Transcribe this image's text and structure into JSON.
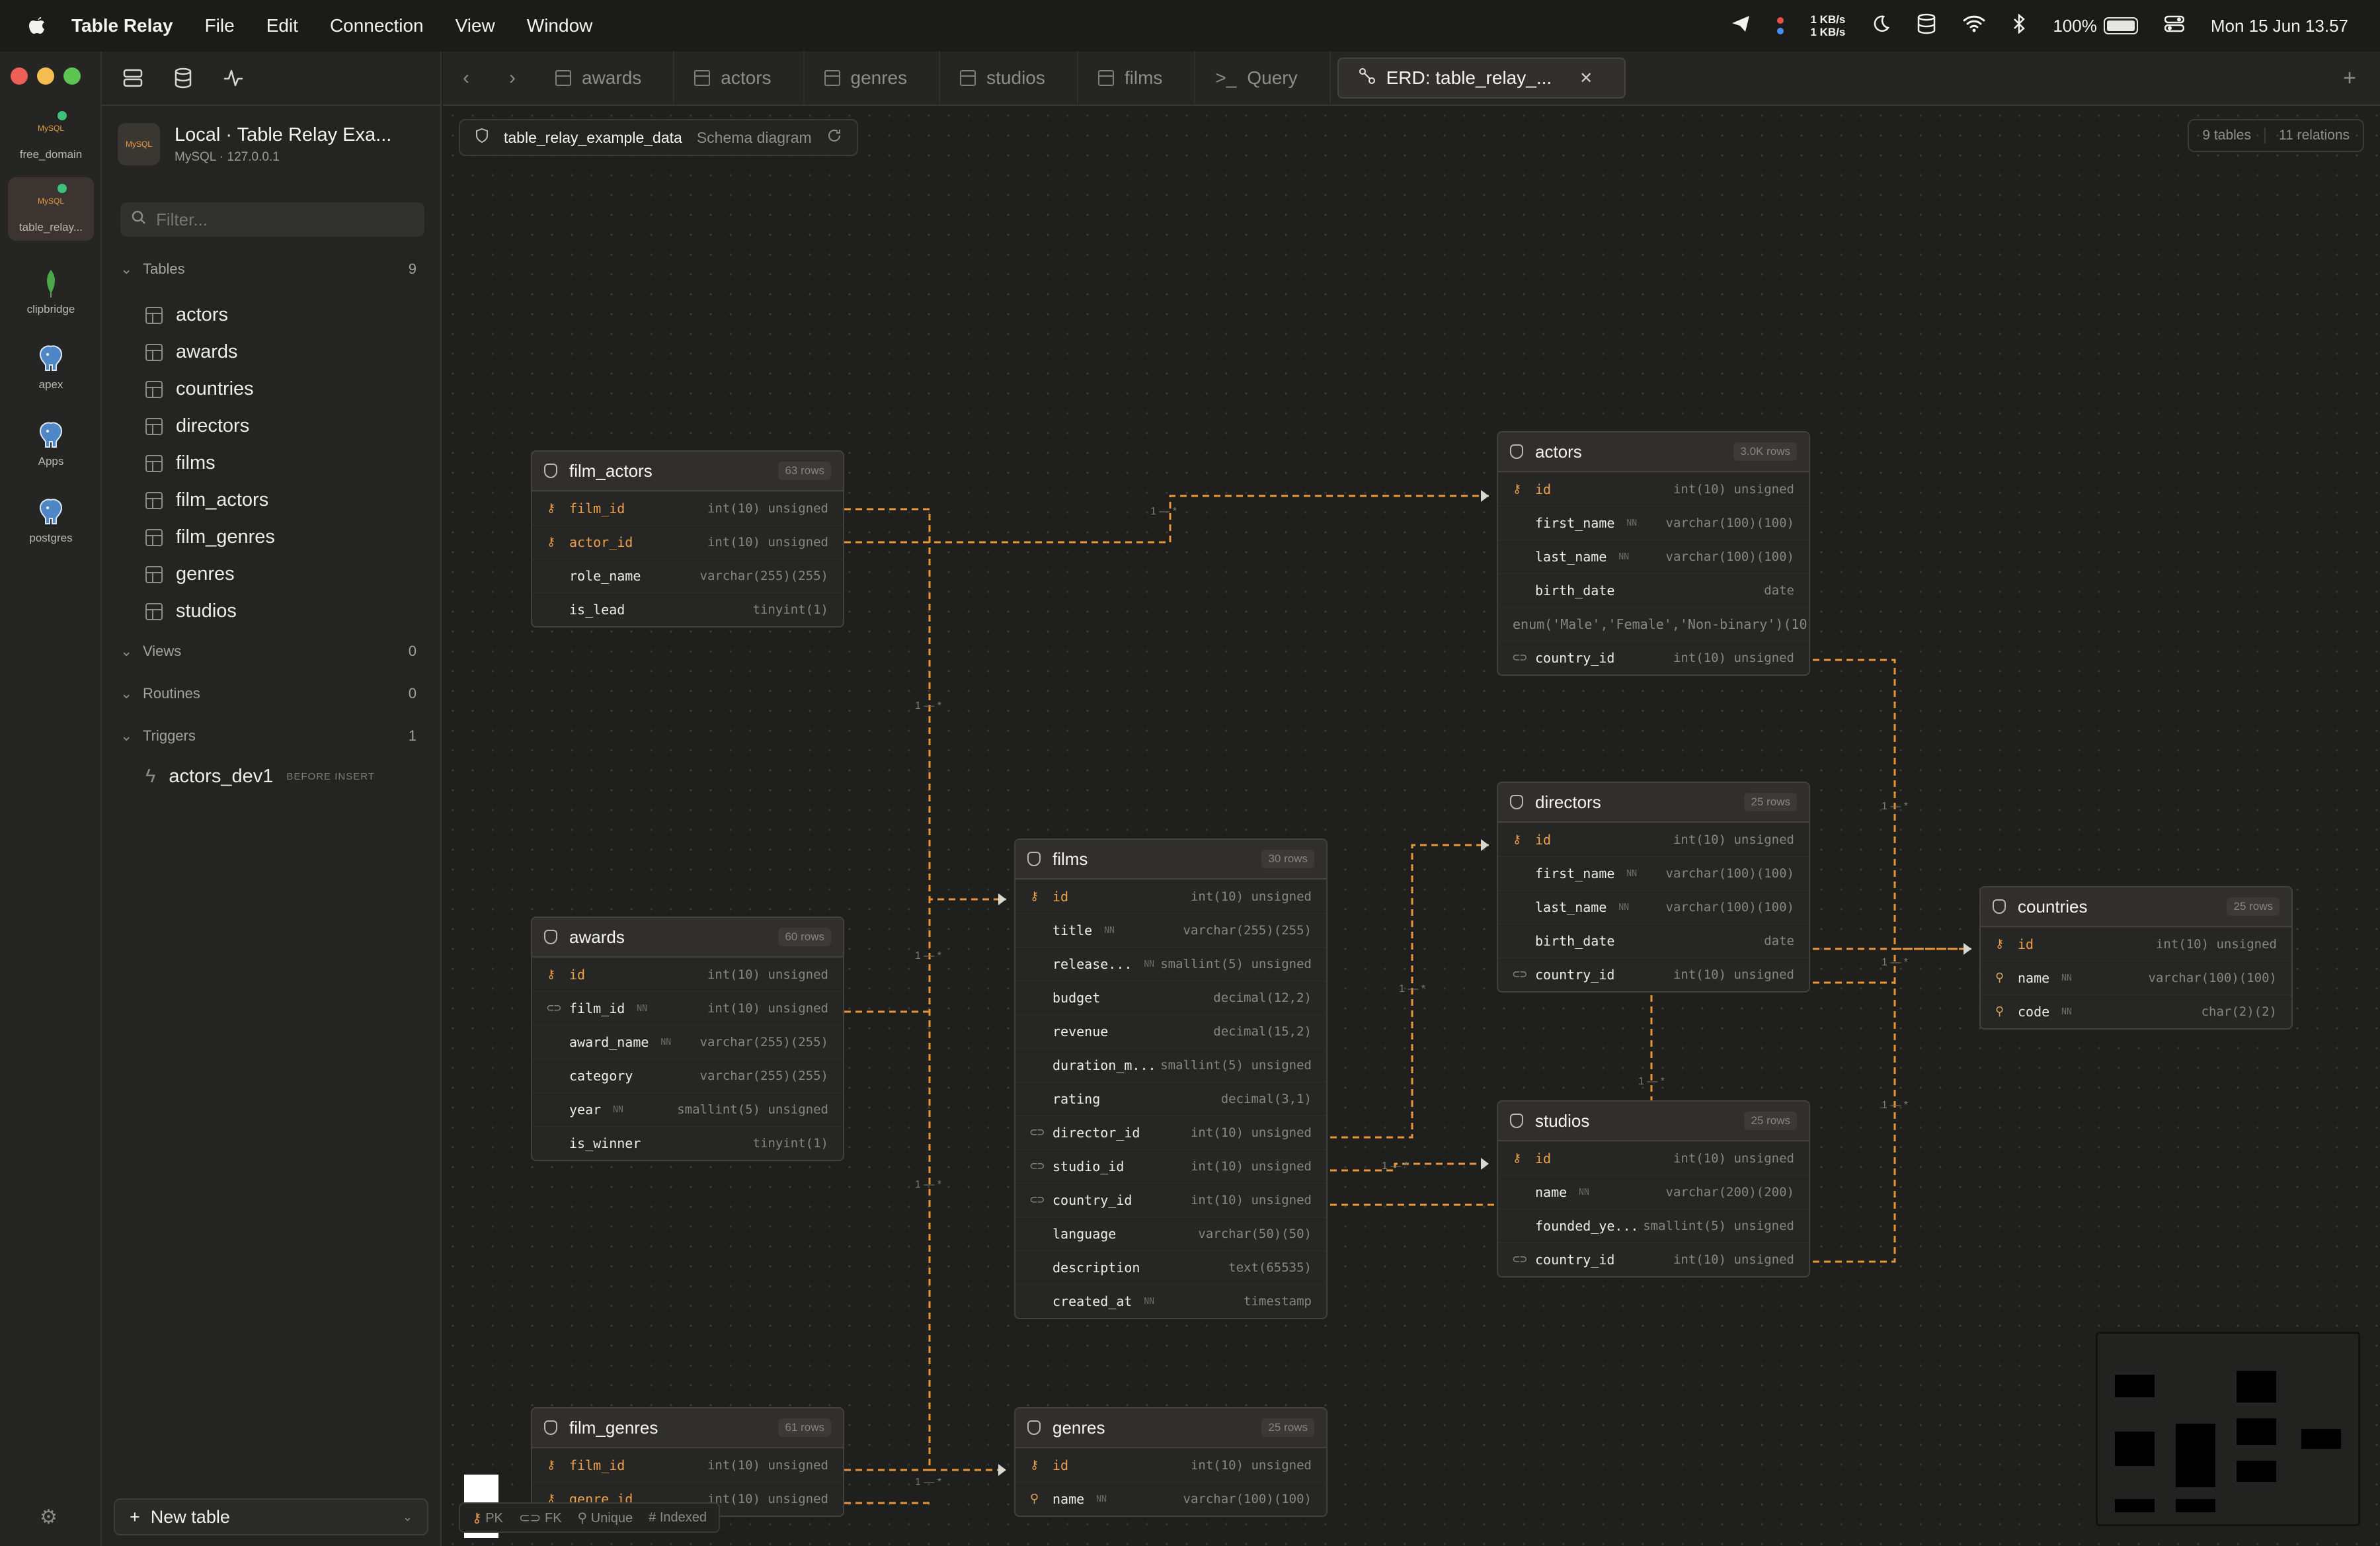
{
  "menubar": {
    "app": "Table Relay",
    "items": [
      "File",
      "Edit",
      "Connection",
      "View",
      "Window"
    ],
    "net_up": "1 KB/s",
    "net_down": "1 KB/s",
    "battery": "100%",
    "clock": "Mon 15 Jun  13.57"
  },
  "connections": [
    {
      "label": "free_domain",
      "icon": "mysql-icon"
    },
    {
      "label": "table_relay...",
      "icon": "mysql-icon"
    },
    {
      "label": "clipbridge",
      "icon": "mongodb-leaf-icon"
    },
    {
      "label": "apex",
      "icon": "postgres-elephant-icon"
    },
    {
      "label": "Apps",
      "icon": "postgres-elephant-icon"
    },
    {
      "label": "postgres",
      "icon": "postgres-elephant-icon"
    }
  ],
  "sidebar": {
    "db_title": "Local · Table Relay Exa...",
    "db_sub": "MySQL · 127.0.0.1",
    "filter_placeholder": "Filter...",
    "tables_label": "Tables",
    "tables_count": "9",
    "tables": [
      "actors",
      "awards",
      "countries",
      "directors",
      "films",
      "film_actors",
      "film_genres",
      "genres",
      "studios"
    ],
    "views_label": "Views",
    "views_count": "0",
    "routines_label": "Routines",
    "routines_count": "0",
    "triggers_label": "Triggers",
    "triggers_count": "1",
    "trigger_name": "actors_dev1",
    "trigger_tag": "BEFORE INSERT",
    "new_table": "New table"
  },
  "tabs": [
    "awards",
    "actors",
    "genres",
    "studios",
    "films",
    "Query",
    "ERD: table_relay_..."
  ],
  "erd": {
    "db": "table_relay_example_data",
    "sub": "Schema diagram",
    "stats_tables": "9 tables",
    "stats_relations": "11 relations",
    "legend": [
      "PK",
      "FK",
      "Unique",
      "Indexed"
    ],
    "cardinality": "1 — *",
    "line_color": "#e8953a"
  },
  "tables": {
    "film_actors": {
      "name": "film_actors",
      "rows": "63 rows",
      "cols": [
        {
          "n": "film_id",
          "t": "int(10) unsigned"
        },
        {
          "n": "actor_id",
          "t": "int(10) unsigned"
        },
        {
          "n": "role_name",
          "t": "varchar(255)(255)"
        },
        {
          "n": "is_lead",
          "t": "tinyint(1)"
        }
      ]
    },
    "awards": {
      "name": "awards",
      "rows": "60 rows",
      "cols": [
        {
          "n": "id",
          "t": "int(10) unsigned"
        },
        {
          "n": "film_id",
          "nn": "NN",
          "t": "int(10) unsigned"
        },
        {
          "n": "award_name",
          "nn": "NN",
          "t": "varchar(255)(255)"
        },
        {
          "n": "category",
          "t": "varchar(255)(255)"
        },
        {
          "n": "year",
          "nn": "NN",
          "t": "smallint(5) unsigned"
        },
        {
          "n": "is_winner",
          "t": "tinyint(1)"
        }
      ]
    },
    "film_genres": {
      "name": "film_genres",
      "rows": "61 rows",
      "cols": [
        {
          "n": "film_id",
          "t": "int(10) unsigned"
        },
        {
          "n": "genre_id",
          "t": "int(10) unsigned"
        }
      ]
    },
    "films": {
      "name": "films",
      "rows": "30 rows",
      "cols": [
        {
          "n": "id",
          "t": "int(10) unsigned"
        },
        {
          "n": "title",
          "nn": "NN",
          "t": "varchar(255)(255)"
        },
        {
          "n": "release...",
          "nn": "NN",
          "t": "smallint(5) unsigned"
        },
        {
          "n": "budget",
          "t": "decimal(12,2)"
        },
        {
          "n": "revenue",
          "t": "decimal(15,2)"
        },
        {
          "n": "duration_m...",
          "t": "smallint(5) unsigned"
        },
        {
          "n": "rating",
          "t": "decimal(3,1)"
        },
        {
          "n": "director_id",
          "t": "int(10) unsigned"
        },
        {
          "n": "studio_id",
          "t": "int(10) unsigned"
        },
        {
          "n": "country_id",
          "t": "int(10) unsigned"
        },
        {
          "n": "language",
          "t": "varchar(50)(50)"
        },
        {
          "n": "description",
          "t": "text(65535)"
        },
        {
          "n": "created_at",
          "nn": "NN",
          "t": "timestamp"
        }
      ]
    },
    "genres": {
      "name": "genres",
      "rows": "25 rows",
      "cols": [
        {
          "n": "id",
          "t": "int(10) unsigned"
        },
        {
          "n": "name",
          "nn": "NN",
          "t": "varchar(100)(100)"
        }
      ]
    },
    "actors": {
      "name": "actors",
      "rows": "3.0K rows",
      "cols": [
        {
          "n": "id",
          "t": "int(10) unsigned"
        },
        {
          "n": "first_name",
          "nn": "NN",
          "t": "varchar(100)(100)"
        },
        {
          "n": "last_name",
          "nn": "NN",
          "t": "varchar(100)(100)"
        },
        {
          "n": "birth_date",
          "t": "date"
        },
        {
          "n": "enum('Male','Female','Non-binary')(10",
          "t": ""
        },
        {
          "n": "country_id",
          "t": "int(10) unsigned"
        }
      ]
    },
    "directors": {
      "name": "directors",
      "rows": "25 rows",
      "cols": [
        {
          "n": "id",
          "t": "int(10) unsigned"
        },
        {
          "n": "first_name",
          "nn": "NN",
          "t": "varchar(100)(100)"
        },
        {
          "n": "last_name",
          "nn": "NN",
          "t": "varchar(100)(100)"
        },
        {
          "n": "birth_date",
          "t": "date"
        },
        {
          "n": "country_id",
          "t": "int(10) unsigned"
        }
      ]
    },
    "studios": {
      "name": "studios",
      "rows": "25 rows",
      "cols": [
        {
          "n": "id",
          "t": "int(10) unsigned"
        },
        {
          "n": "name",
          "nn": "NN",
          "t": "varchar(200)(200)"
        },
        {
          "n": "founded_ye...",
          "t": "smallint(5) unsigned"
        },
        {
          "n": "country_id",
          "t": "int(10) unsigned"
        }
      ]
    },
    "countries": {
      "name": "countries",
      "rows": "25 rows",
      "cols": [
        {
          "n": "id",
          "t": "int(10) unsigned"
        },
        {
          "n": "name",
          "nn": "NN",
          "t": "varchar(100)(100)"
        },
        {
          "n": "code",
          "nn": "NN",
          "t": "char(2)(2)"
        }
      ]
    }
  }
}
